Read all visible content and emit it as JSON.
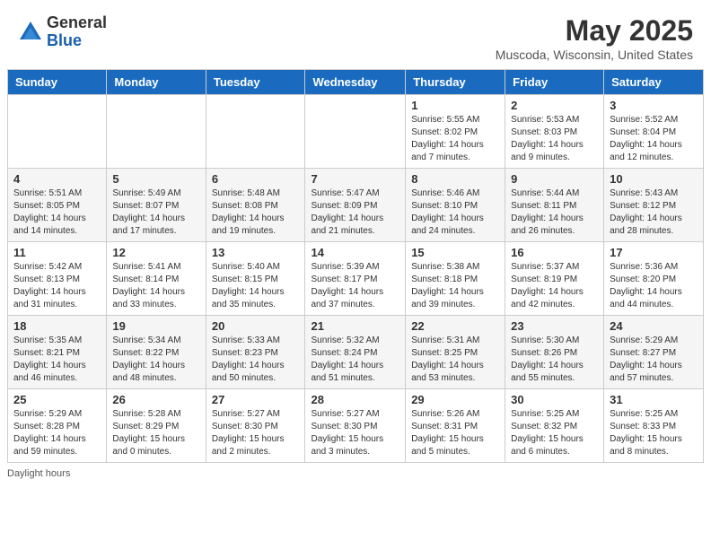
{
  "header": {
    "logo_general": "General",
    "logo_blue": "Blue",
    "month_title": "May 2025",
    "subtitle": "Muscoda, Wisconsin, United States"
  },
  "days_of_week": [
    "Sunday",
    "Monday",
    "Tuesday",
    "Wednesday",
    "Thursday",
    "Friday",
    "Saturday"
  ],
  "weeks": [
    [
      {
        "day": "",
        "content": ""
      },
      {
        "day": "",
        "content": ""
      },
      {
        "day": "",
        "content": ""
      },
      {
        "day": "",
        "content": ""
      },
      {
        "day": "1",
        "content": "Sunrise: 5:55 AM\nSunset: 8:02 PM\nDaylight: 14 hours\nand 7 minutes."
      },
      {
        "day": "2",
        "content": "Sunrise: 5:53 AM\nSunset: 8:03 PM\nDaylight: 14 hours\nand 9 minutes."
      },
      {
        "day": "3",
        "content": "Sunrise: 5:52 AM\nSunset: 8:04 PM\nDaylight: 14 hours\nand 12 minutes."
      }
    ],
    [
      {
        "day": "4",
        "content": "Sunrise: 5:51 AM\nSunset: 8:05 PM\nDaylight: 14 hours\nand 14 minutes."
      },
      {
        "day": "5",
        "content": "Sunrise: 5:49 AM\nSunset: 8:07 PM\nDaylight: 14 hours\nand 17 minutes."
      },
      {
        "day": "6",
        "content": "Sunrise: 5:48 AM\nSunset: 8:08 PM\nDaylight: 14 hours\nand 19 minutes."
      },
      {
        "day": "7",
        "content": "Sunrise: 5:47 AM\nSunset: 8:09 PM\nDaylight: 14 hours\nand 21 minutes."
      },
      {
        "day": "8",
        "content": "Sunrise: 5:46 AM\nSunset: 8:10 PM\nDaylight: 14 hours\nand 24 minutes."
      },
      {
        "day": "9",
        "content": "Sunrise: 5:44 AM\nSunset: 8:11 PM\nDaylight: 14 hours\nand 26 minutes."
      },
      {
        "day": "10",
        "content": "Sunrise: 5:43 AM\nSunset: 8:12 PM\nDaylight: 14 hours\nand 28 minutes."
      }
    ],
    [
      {
        "day": "11",
        "content": "Sunrise: 5:42 AM\nSunset: 8:13 PM\nDaylight: 14 hours\nand 31 minutes."
      },
      {
        "day": "12",
        "content": "Sunrise: 5:41 AM\nSunset: 8:14 PM\nDaylight: 14 hours\nand 33 minutes."
      },
      {
        "day": "13",
        "content": "Sunrise: 5:40 AM\nSunset: 8:15 PM\nDaylight: 14 hours\nand 35 minutes."
      },
      {
        "day": "14",
        "content": "Sunrise: 5:39 AM\nSunset: 8:17 PM\nDaylight: 14 hours\nand 37 minutes."
      },
      {
        "day": "15",
        "content": "Sunrise: 5:38 AM\nSunset: 8:18 PM\nDaylight: 14 hours\nand 39 minutes."
      },
      {
        "day": "16",
        "content": "Sunrise: 5:37 AM\nSunset: 8:19 PM\nDaylight: 14 hours\nand 42 minutes."
      },
      {
        "day": "17",
        "content": "Sunrise: 5:36 AM\nSunset: 8:20 PM\nDaylight: 14 hours\nand 44 minutes."
      }
    ],
    [
      {
        "day": "18",
        "content": "Sunrise: 5:35 AM\nSunset: 8:21 PM\nDaylight: 14 hours\nand 46 minutes."
      },
      {
        "day": "19",
        "content": "Sunrise: 5:34 AM\nSunset: 8:22 PM\nDaylight: 14 hours\nand 48 minutes."
      },
      {
        "day": "20",
        "content": "Sunrise: 5:33 AM\nSunset: 8:23 PM\nDaylight: 14 hours\nand 50 minutes."
      },
      {
        "day": "21",
        "content": "Sunrise: 5:32 AM\nSunset: 8:24 PM\nDaylight: 14 hours\nand 51 minutes."
      },
      {
        "day": "22",
        "content": "Sunrise: 5:31 AM\nSunset: 8:25 PM\nDaylight: 14 hours\nand 53 minutes."
      },
      {
        "day": "23",
        "content": "Sunrise: 5:30 AM\nSunset: 8:26 PM\nDaylight: 14 hours\nand 55 minutes."
      },
      {
        "day": "24",
        "content": "Sunrise: 5:29 AM\nSunset: 8:27 PM\nDaylight: 14 hours\nand 57 minutes."
      }
    ],
    [
      {
        "day": "25",
        "content": "Sunrise: 5:29 AM\nSunset: 8:28 PM\nDaylight: 14 hours\nand 59 minutes."
      },
      {
        "day": "26",
        "content": "Sunrise: 5:28 AM\nSunset: 8:29 PM\nDaylight: 15 hours\nand 0 minutes."
      },
      {
        "day": "27",
        "content": "Sunrise: 5:27 AM\nSunset: 8:30 PM\nDaylight: 15 hours\nand 2 minutes."
      },
      {
        "day": "28",
        "content": "Sunrise: 5:27 AM\nSunset: 8:30 PM\nDaylight: 15 hours\nand 3 minutes."
      },
      {
        "day": "29",
        "content": "Sunrise: 5:26 AM\nSunset: 8:31 PM\nDaylight: 15 hours\nand 5 minutes."
      },
      {
        "day": "30",
        "content": "Sunrise: 5:25 AM\nSunset: 8:32 PM\nDaylight: 15 hours\nand 6 minutes."
      },
      {
        "day": "31",
        "content": "Sunrise: 5:25 AM\nSunset: 8:33 PM\nDaylight: 15 hours\nand 8 minutes."
      }
    ]
  ],
  "footer": {
    "daylight_label": "Daylight hours"
  }
}
